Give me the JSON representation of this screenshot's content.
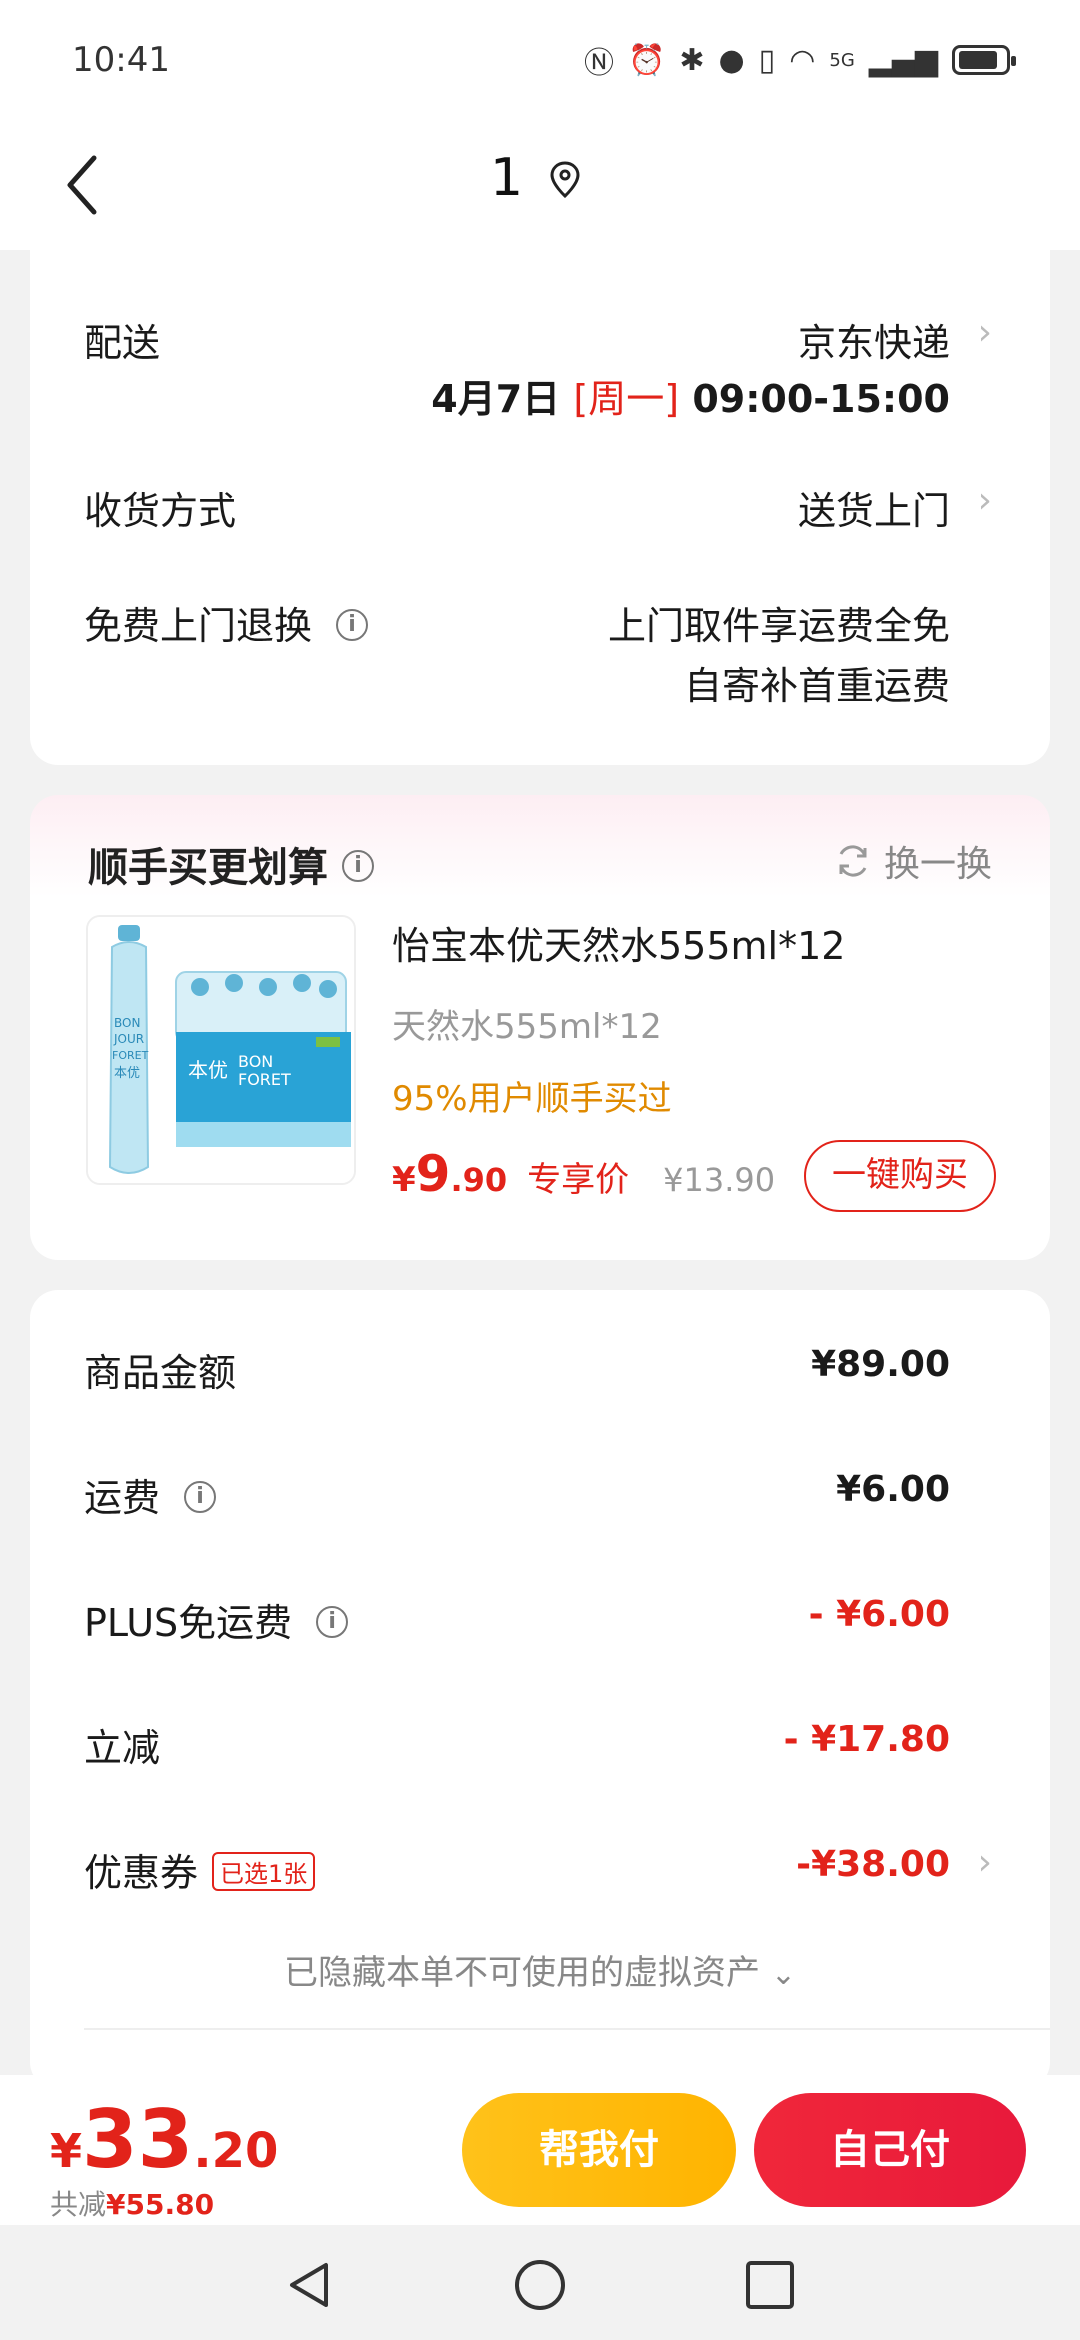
{
  "status_bar": {
    "time": "10:41",
    "network": "5G"
  },
  "header": {
    "title": "1"
  },
  "delivery": {
    "label": "配送",
    "carrier": "京东快递",
    "date": "4月7日",
    "weekday": "[周一]",
    "time_window": "09:00-15:00",
    "receive_label": "收货方式",
    "receive_value": "送货上门",
    "return_label": "免费上门退换",
    "return_line1": "上门取件享运费全免",
    "return_line2": "自寄补首重运费"
  },
  "upsell": {
    "title": "顺手买更划算",
    "swap_label": "换一换",
    "product_name": "怡宝本优天然水555ml*12",
    "product_spec": "天然水555ml*12",
    "hint": "95%用户顺手买过",
    "price_yen": "¥",
    "price_int": "9",
    "price_dec": ".90",
    "price_tag": "专享价",
    "original_price": "¥13.90",
    "buy_label": "一键购买",
    "image_text": {
      "brand_line1": "BON",
      "brand_line2": "JOUR",
      "brand_line3": "FORET",
      "cn": "本优"
    }
  },
  "summary": {
    "rows": [
      {
        "label": "商品金额",
        "value": "¥89.00"
      },
      {
        "label": "运费",
        "value": "¥6.00"
      },
      {
        "label": "PLUS免运费",
        "value": "- ¥6.00"
      },
      {
        "label": "立减",
        "value": "- ¥17.80"
      },
      {
        "label": "优惠券",
        "value": "-¥38.00",
        "badge": "已选1张"
      }
    ],
    "hidden_note": "已隐藏本单不可使用的虚拟资产"
  },
  "bottom": {
    "total_yen": "¥",
    "total_int": "33",
    "total_dec": ".20",
    "saved_label": "共减",
    "saved_value": "¥55.80",
    "help_pay": "帮我付",
    "self_pay": "自己付"
  },
  "colors": {
    "accent": "#e2231a",
    "help_button": "#ffba10",
    "self_button": "#ec2039",
    "hint": "#e08a00"
  }
}
